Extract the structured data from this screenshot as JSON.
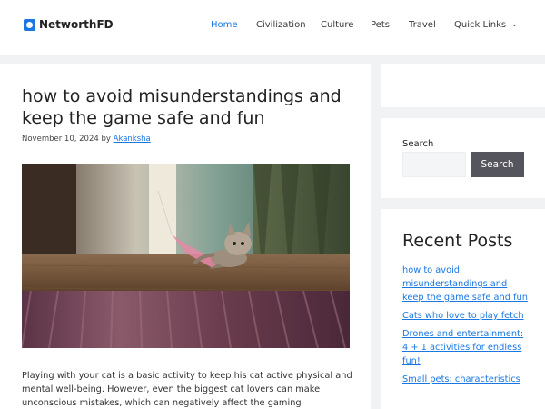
{
  "site": {
    "name": "NetworthFD"
  },
  "nav": {
    "items": [
      {
        "label": "Home"
      },
      {
        "label": "Civilization"
      },
      {
        "label": "Culture"
      },
      {
        "label": "Pets"
      },
      {
        "label": "Travel"
      },
      {
        "label": "Quick Links"
      }
    ]
  },
  "article": {
    "title": "how to avoid misunderstandings and keep the game safe and fun",
    "date": "November 10, 2024",
    "by": "by",
    "author": "Akanksha",
    "image_icon": "kitten-playing-photo",
    "paragraph": "Playing with your cat is a basic activity to keep his cat active physical and mental well-being. However, even the biggest cat lovers can make unconscious mistakes, which can negatively affect the gaming"
  },
  "search": {
    "label": "Search",
    "button": "Search",
    "value": ""
  },
  "recent": {
    "title": "Recent Posts",
    "items": [
      {
        "label": "how to avoid misunderstandings and keep the game safe and fun"
      },
      {
        "label": "Cats who love to play fetch"
      },
      {
        "label": "Drones and entertainment: 4 + 1 activities for endless fun!"
      },
      {
        "label": "Small pets: characteristics"
      }
    ]
  },
  "colors": {
    "accent": "#1b78e2",
    "button": "#55555e",
    "background": "#f1f2f3"
  }
}
